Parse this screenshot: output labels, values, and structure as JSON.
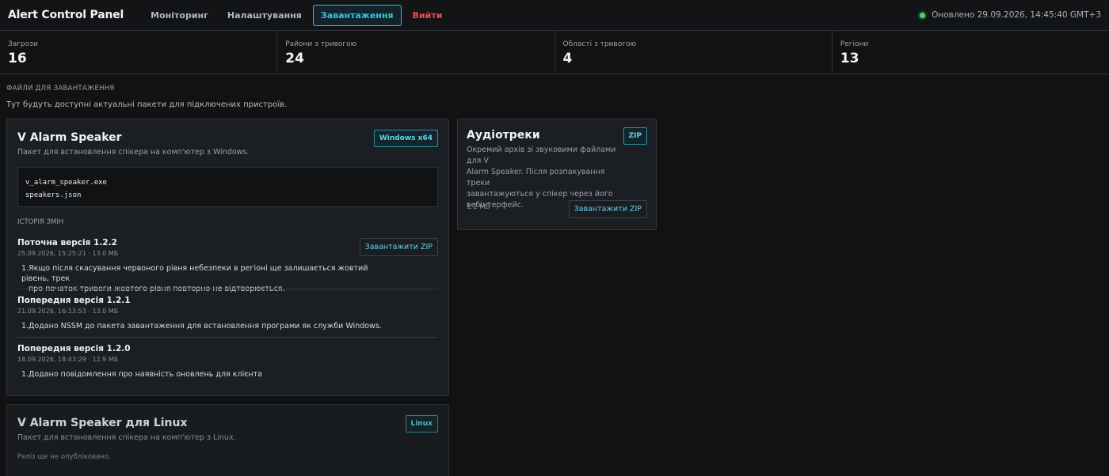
{
  "app": {
    "title": "Alert Control Panel"
  },
  "nav": [
    {
      "label": "Моніторинг",
      "active": false,
      "danger": false
    },
    {
      "label": "Налаштування",
      "active": false,
      "danger": false
    },
    {
      "label": "Завантаження",
      "active": true,
      "danger": false
    },
    {
      "label": "Вийти",
      "active": false,
      "danger": true
    }
  ],
  "status": {
    "text": "Оновлено 29.09.2026, 14:45:40 GMT+3"
  },
  "stats": [
    {
      "label": "Загрози",
      "value": "16"
    },
    {
      "label": "Райони з тривогою",
      "value": "24"
    },
    {
      "label": "Області з тривогою",
      "value": "4"
    },
    {
      "label": "Регіони",
      "value": "13"
    }
  ],
  "section": {
    "title": "ФАЙЛИ ДЛЯ ЗАВАНТАЖЕННЯ",
    "subtitle": "Тут будуть доступні актуальні пакети для підключених пристроїв."
  },
  "speaker": {
    "title": "V Alarm Speaker",
    "badge": "Windows x64",
    "desc": "Пакет для встановлення спікера на комп'ютер з Windows.",
    "files": [
      "v_alarm_speaker.exe",
      "speakers.json"
    ],
    "history_label": "ІСТОРІЯ ЗМІН",
    "download_label": "Завантажити ZIP",
    "versions": [
      {
        "title": "Поточна версія 1.2.2",
        "meta": "25.09.2026, 15:25:21 · 13.0 МБ",
        "num": "1.",
        "note_line1": "Якщо після скасування червоного рівня небезпеки в регіоні ще залишається жовтий рівень, трек",
        "note_line2": "про початок тривоги жовтого рівня повторно не відтворюється."
      },
      {
        "title": "Попередня версія 1.2.1",
        "meta": "21.09.2026, 16:13:53 · 13.0 МБ",
        "num": "1.",
        "note_line1": "Додано NSSM до пакета завантаження для встановлення програми як служби Windows."
      },
      {
        "title": "Попередня версія 1.2.0",
        "meta": "18.09.2026, 18:43:29 · 12.9 МБ",
        "num": "1.",
        "note_line1": "Додано повідомлення про наявність оновлень для клієнта"
      }
    ]
  },
  "audio": {
    "title": "Аудіотреки",
    "badge": "ZIP",
    "desc_line1": "Окремий архів зі звуковими файлами для V",
    "desc_line2": "Alarm Speaker. Після розпакування треки",
    "desc_line3": "завантажуються у спікер через його",
    "desc_line4": "вебінтерфейс.",
    "size": "1.1 МБ",
    "download_label": "Завантажити ZIP"
  },
  "linux": {
    "title": "V Alarm Speaker для Linux",
    "badge": "Linux",
    "desc": "Пакет для встановлення спікера на комп'ютер з Linux.",
    "note": "Реліз ще не опубліковано."
  },
  "colors": {
    "accent": "#33c3e3",
    "danger": "#ef4b4b",
    "online": "#3ddc6a",
    "background": "#121212",
    "card": "#1b1e22"
  }
}
